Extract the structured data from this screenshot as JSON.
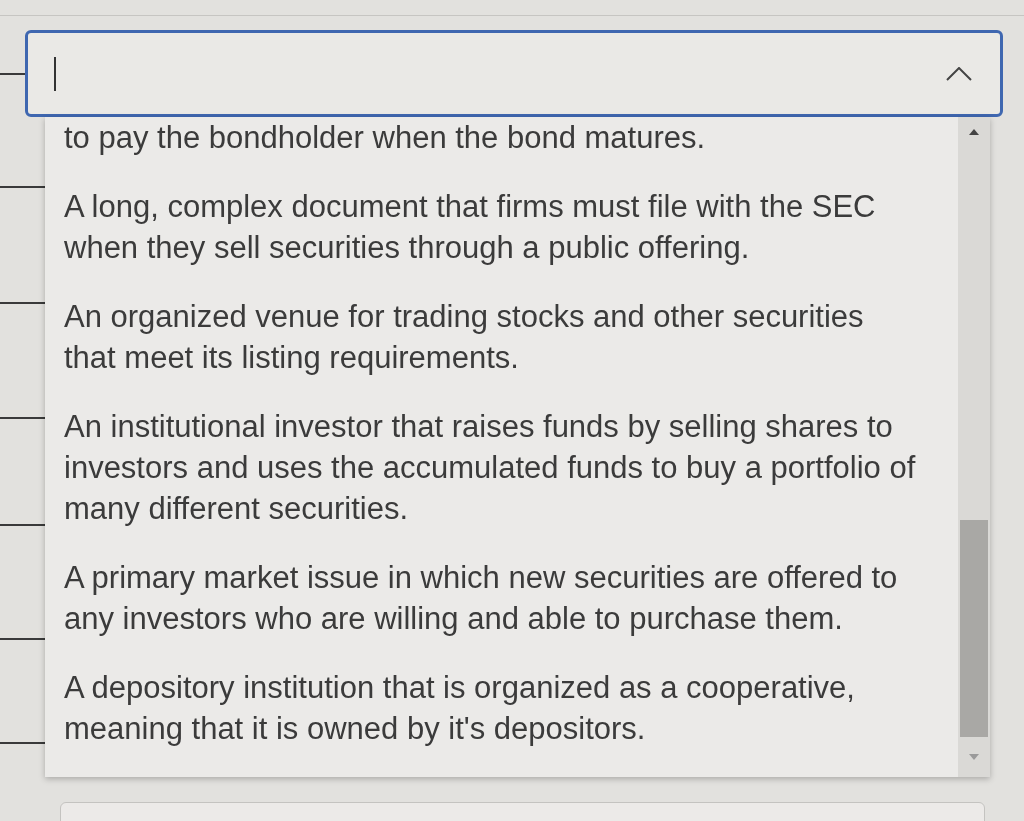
{
  "combobox": {
    "focused": true,
    "expanded": true
  },
  "options": [
    {
      "text": "to pay the bondholder when the bond matures.",
      "selected": false
    },
    {
      "text": "A long, complex document that firms must file with the SEC when they sell securities through a public offering.",
      "selected": false
    },
    {
      "text": "An organized venue for trading stocks and other securities that meet its listing requirements.",
      "selected": false
    },
    {
      "text": "An institutional investor that raises funds by selling shares to investors and uses the accumulated funds to buy a portfolio of many different securities.",
      "selected": false
    },
    {
      "text": "A primary market issue in which new securities are offered to any investors who are willing and able to purchase them.",
      "selected": false
    },
    {
      "text": "A depository institution that is organized as a cooperative, meaning that it is owned by it's depositors.",
      "selected": false
    }
  ]
}
